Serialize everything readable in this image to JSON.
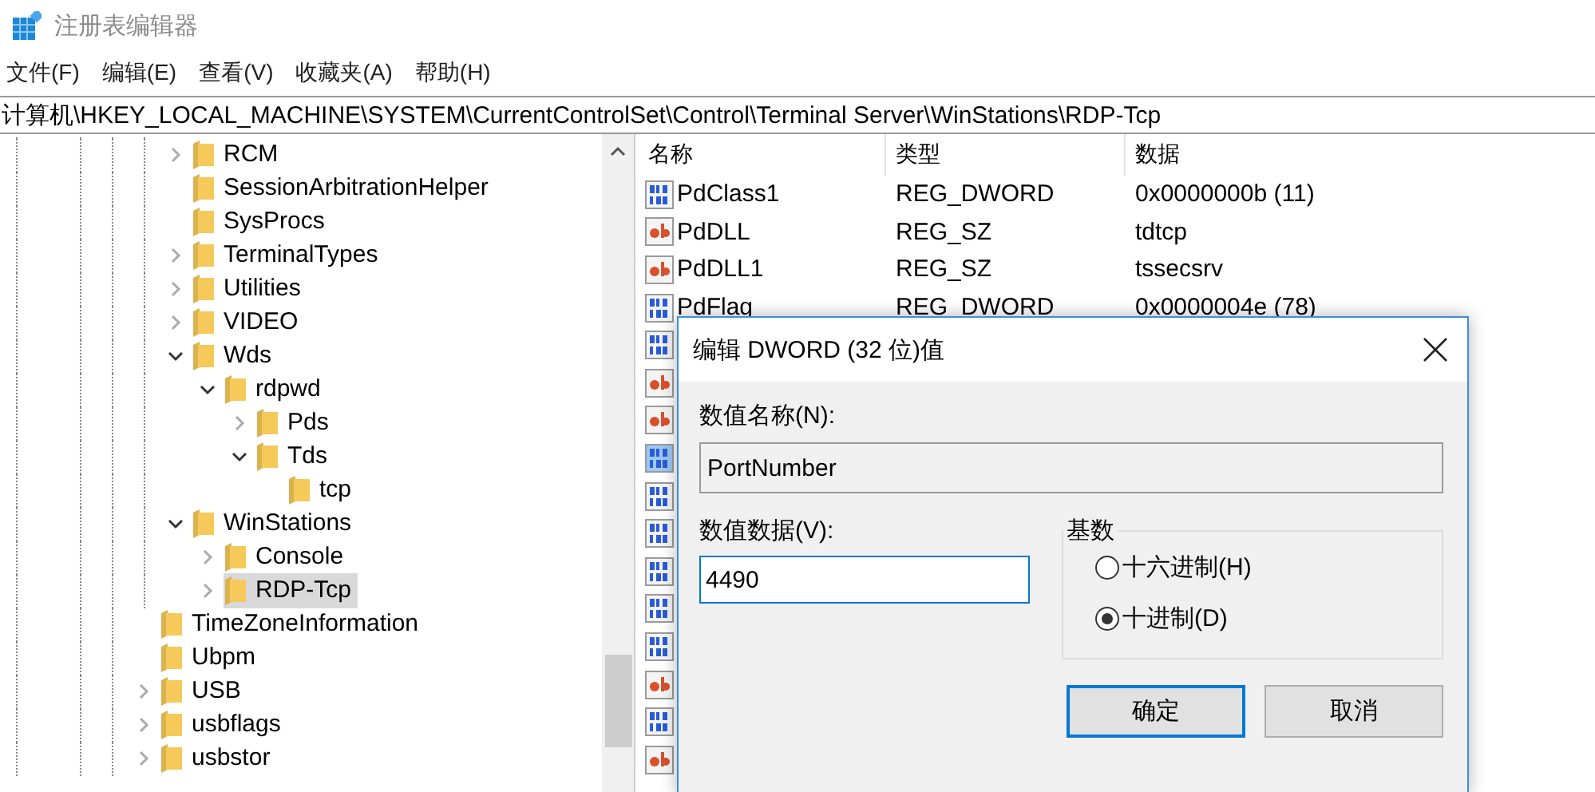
{
  "window": {
    "title": "注册表编辑器"
  },
  "menu": [
    "文件(F)",
    "编辑(E)",
    "查看(V)",
    "收藏夹(A)",
    "帮助(H)"
  ],
  "address": "计算机\\HKEY_LOCAL_MACHINE\\SYSTEM\\CurrentControlSet\\Control\\Terminal Server\\WinStations\\RDP-Tcp",
  "tree": [
    {
      "children": [
        {
          "label": "RCM",
          "expanded": false,
          "selected": false
        },
        {
          "label": "SessionArbitrationHelper",
          "selected": false
        },
        {
          "label": "SysProcs",
          "selected": false
        },
        {
          "label": "TerminalTypes",
          "expanded": false,
          "selected": false
        },
        {
          "label": "Utilities",
          "expanded": false,
          "selected": false
        },
        {
          "label": "VIDEO",
          "expanded": false,
          "selected": false
        },
        {
          "label": "Wds",
          "expanded": true,
          "selected": false,
          "children": [
            {
              "label": "rdpwd",
              "expanded": true,
              "selected": false,
              "children": [
                {
                  "label": "Pds",
                  "expanded": false,
                  "selected": false
                },
                {
                  "label": "Tds",
                  "expanded": true,
                  "selected": false,
                  "children": [
                    {
                      "label": "tcp",
                      "selected": false
                    }
                  ]
                }
              ]
            }
          ]
        },
        {
          "label": "WinStations",
          "expanded": true,
          "selected": false,
          "children": [
            {
              "label": "Console",
              "expanded": false,
              "selected": false
            },
            {
              "label": "RDP-Tcp",
              "expanded": false,
              "selected": true
            }
          ]
        }
      ]
    },
    {
      "label": "TimeZoneInformation",
      "selected": false
    },
    {
      "label": "Ubpm",
      "selected": false
    },
    {
      "label": "USB",
      "expanded": false,
      "selected": false
    },
    {
      "label": "usbflags",
      "expanded": false,
      "selected": false
    },
    {
      "label": "usbstor",
      "expanded": false,
      "selected": false
    }
  ],
  "list": {
    "columns": [
      "名称",
      "类型",
      "数据"
    ],
    "rows": [
      {
        "kind": "dword",
        "name": "PdClass1",
        "reg_type": "REG_DWORD",
        "data": "0x0000000b (11)",
        "selected": false
      },
      {
        "kind": "sz",
        "name": "PdDLL",
        "reg_type": "REG_SZ",
        "data": "tdtcp",
        "selected": false
      },
      {
        "kind": "sz",
        "name": "PdDLL1",
        "reg_type": "REG_SZ",
        "data": "tssecsrv",
        "selected": false
      },
      {
        "kind": "dword",
        "name": "PdFlag",
        "reg_type": "REG_DWORD",
        "data": "0x0000004e (78)",
        "selected": false
      },
      {
        "kind": "dword",
        "selected": false
      },
      {
        "kind": "sz",
        "selected": false
      },
      {
        "kind": "sz",
        "selected": false
      },
      {
        "kind": "dword",
        "selected": true
      },
      {
        "kind": "dword",
        "selected": false
      },
      {
        "kind": "dword",
        "selected": false
      },
      {
        "kind": "dword",
        "selected": false
      },
      {
        "kind": "dword",
        "selected": false
      },
      {
        "kind": "dword",
        "selected": false
      },
      {
        "kind": "sz",
        "selected": false
      },
      {
        "kind": "dword",
        "selected": false
      },
      {
        "kind": "sz",
        "selected": false
      }
    ]
  },
  "dialog": {
    "title": "编辑 DWORD (32 位)值",
    "name_label": "数值名称(N):",
    "name_value": "PortNumber",
    "data_label": "数值数据(V):",
    "data_value": "4490",
    "base_label": "基数",
    "radios": [
      {
        "label": "十六进制(H)",
        "selected": false
      },
      {
        "label": "十进制(D)",
        "selected": true
      }
    ],
    "buttons": [
      {
        "label": "确定",
        "default": true
      },
      {
        "label": "取消",
        "default": false
      }
    ]
  }
}
